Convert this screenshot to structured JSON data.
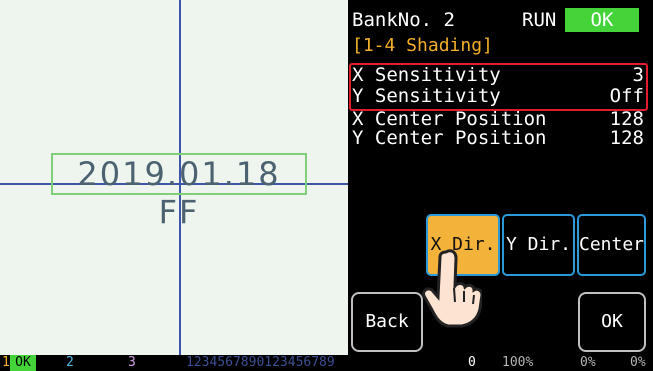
{
  "stamp_text": "2019.01.18 FF",
  "header": {
    "bank": "BankNo. 2",
    "run": "RUN",
    "ok": "OK"
  },
  "subtitle": "[1-4 Shading]",
  "params": [
    {
      "label": "X Sensitivity",
      "value": "3"
    },
    {
      "label": "Y Sensitivity",
      "value": "Off"
    },
    {
      "label": "X Center Position",
      "value": "128"
    },
    {
      "label": "Y Center Position",
      "value": "128"
    }
  ],
  "buttons": {
    "x_dir": "X Dir.",
    "y_dir": "Y Dir.",
    "center": "Center",
    "back": "Back",
    "ok": "OK"
  },
  "status": {
    "b1_num": "1",
    "b1_state": "OK",
    "b2_num": "2",
    "b3_num": "3",
    "counter": "1234567890123456789",
    "zero": "0",
    "pct1": "100%",
    "pct2": "0%",
    "pct3": "0%"
  },
  "colors": {
    "accent_orange": "#f3b33b",
    "ok_green": "#44d43a",
    "highlight_red": "#e11c2c",
    "button_border": "#2b9ad8"
  }
}
